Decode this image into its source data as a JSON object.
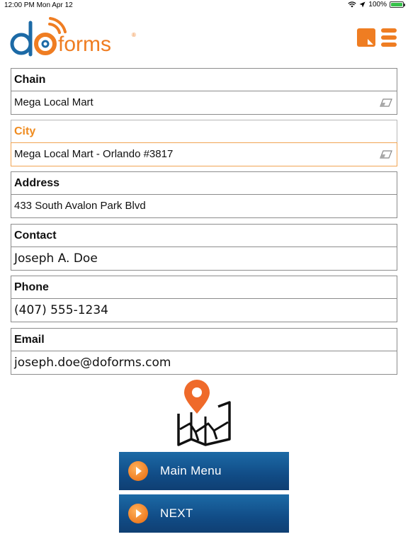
{
  "status_bar": {
    "time_date": "12:00 PM  Mon Apr 12",
    "battery": "100%"
  },
  "brand": {
    "logo_do": "do",
    "logo_forms": "forms",
    "logo_reg": "®",
    "accent_color": "#ef7d22",
    "blue_color": "#1c6aa6"
  },
  "form": {
    "fields": [
      {
        "label": "Chain",
        "value": "Mega Local Mart"
      },
      {
        "label": "City",
        "value": "Mega Local Mart - Orlando #3817"
      },
      {
        "label": "Address",
        "value": "433 South Avalon Park Blvd"
      },
      {
        "label": "Contact",
        "value": "Joseph A. Doe"
      },
      {
        "label": "Phone",
        "value": "(407) 555-1234"
      },
      {
        "label": "Email",
        "value": "joseph.doe@doforms.com"
      }
    ]
  },
  "buttons": {
    "main_menu": "Main Menu",
    "next": "NEXT"
  },
  "icons": [
    "note-icon",
    "menu-icon",
    "eraser-icon",
    "map-icon",
    "play-icon"
  ]
}
